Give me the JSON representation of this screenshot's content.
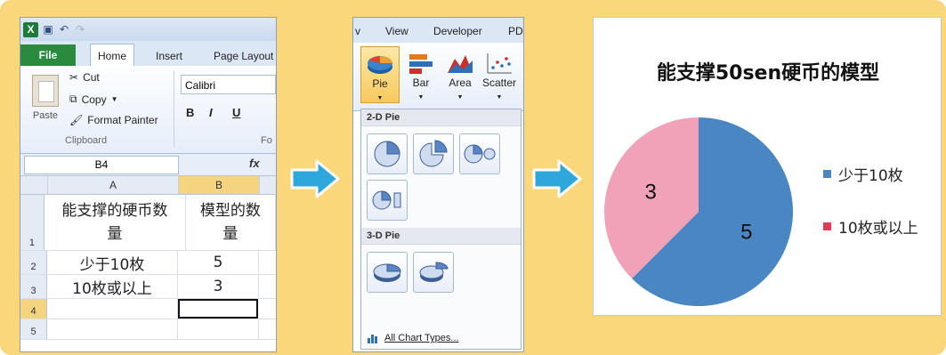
{
  "excel": {
    "tabs": {
      "file": "File",
      "home": "Home",
      "insert": "Insert",
      "page_layout": "Page Layout"
    },
    "clipboard": {
      "paste": "Paste",
      "cut": "Cut",
      "copy": "Copy",
      "format_painter": "Format Painter",
      "group_label": "Clipboard"
    },
    "font": {
      "name": "Calibri",
      "bold": "B",
      "italic": "I",
      "underline": "U",
      "group_label": "Fo"
    },
    "name_box": "B4",
    "fx_label": "fx",
    "columns": [
      "A",
      "B"
    ],
    "rows": [
      {
        "num": "1",
        "a": "能支撑的硬币数量",
        "b": "模型的数量"
      },
      {
        "num": "2",
        "a": "少于10枚",
        "b": "5"
      },
      {
        "num": "3",
        "a": "10枚或以上",
        "b": "3"
      },
      {
        "num": "4",
        "a": "",
        "b": ""
      },
      {
        "num": "5",
        "a": "",
        "b": ""
      }
    ]
  },
  "gallery": {
    "tabs": [
      "v",
      "View",
      "Developer",
      "PDI"
    ],
    "buttons": [
      {
        "label": "Pie"
      },
      {
        "label": "Bar"
      },
      {
        "label": "Area"
      },
      {
        "label": "Scatter"
      }
    ],
    "sections": {
      "two_d": "2-D Pie",
      "three_d": "3-D Pie"
    },
    "all_chart_types": "All Chart Types..."
  },
  "chart": {
    "title": "能支撑50sen硬币的模型",
    "colors": {
      "less": "#4a86c2",
      "more": "#f1a2b9",
      "legend_more": "#e23b57"
    }
  },
  "chart_data": {
    "type": "pie",
    "title": "能支撑50sen硬币的模型",
    "categories": [
      "少于10枚",
      "10枚或以上"
    ],
    "values": [
      5,
      3
    ],
    "legend_position": "right"
  }
}
